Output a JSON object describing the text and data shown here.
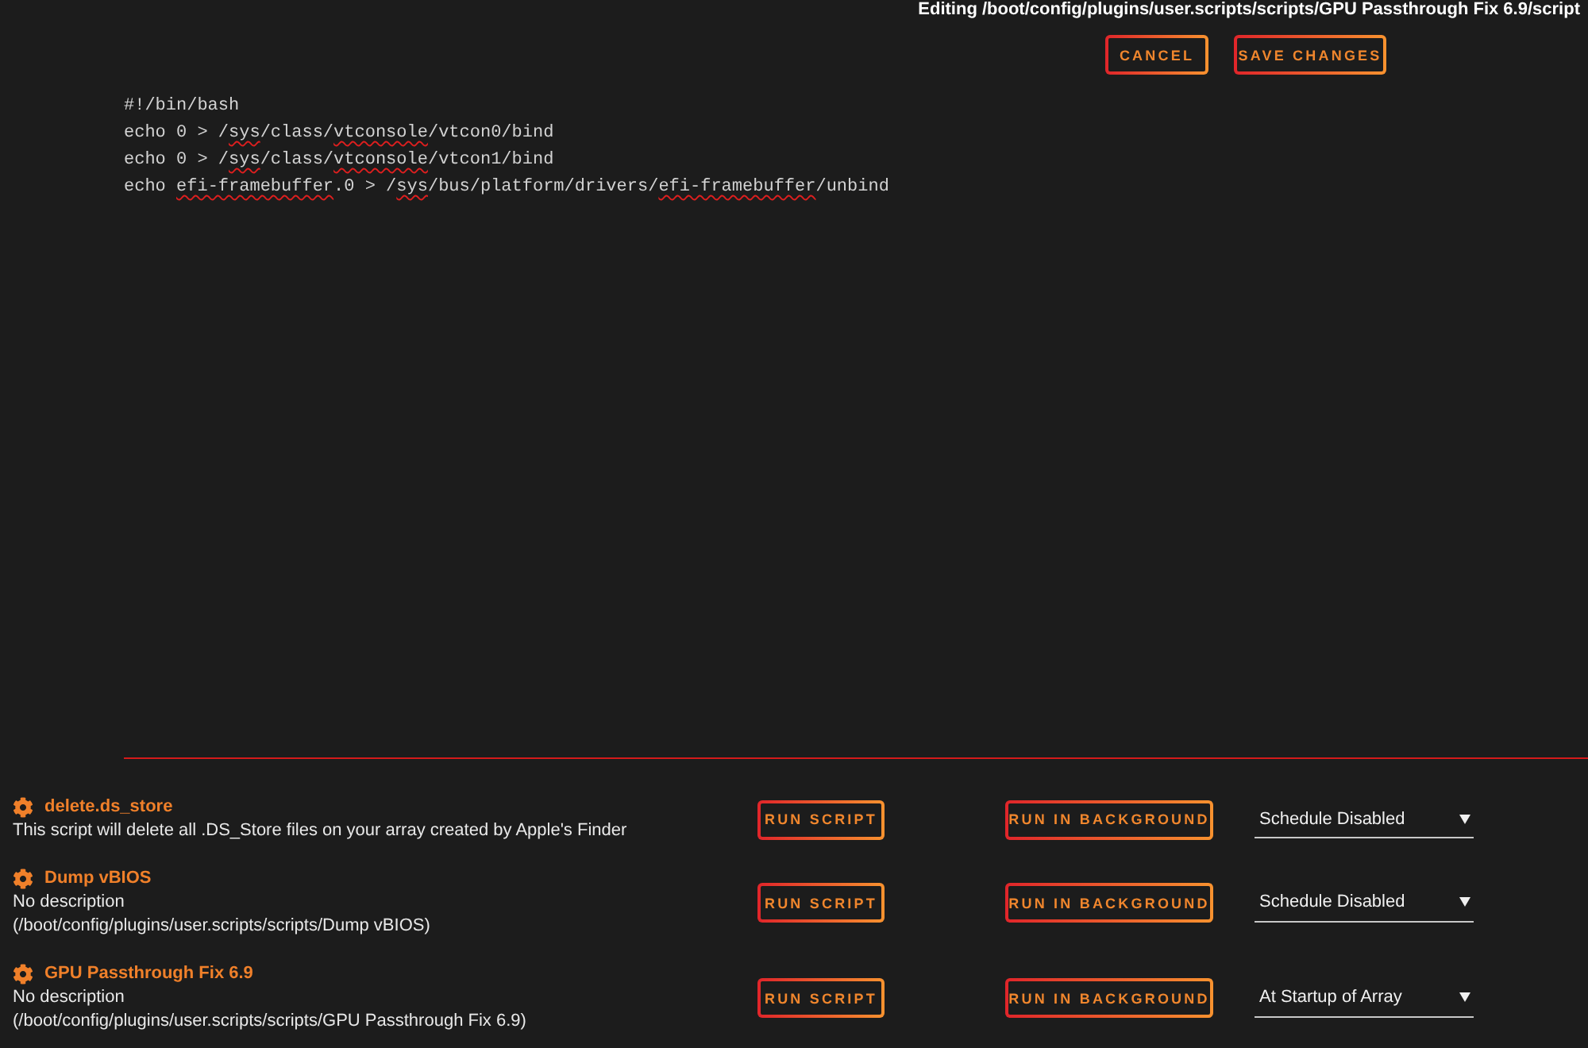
{
  "header": {
    "title": "Editing /boot/config/plugins/user.scripts/scripts/GPU Passthrough Fix 6.9/script",
    "buttons": [
      "CANCEL",
      "SAVE CHANGES"
    ]
  },
  "editor": {
    "lines": [
      {
        "segments": [
          {
            "text": "#!/bin/bash",
            "misspelled": false
          }
        ]
      },
      {
        "segments": [
          {
            "text": "echo 0 > /",
            "misspelled": false
          },
          {
            "text": "sys",
            "misspelled": true
          },
          {
            "text": "/class/",
            "misspelled": false
          },
          {
            "text": "vtconsole",
            "misspelled": true
          },
          {
            "text": "/vtcon0/bind",
            "misspelled": false
          }
        ]
      },
      {
        "segments": [
          {
            "text": "echo 0 > /",
            "misspelled": false
          },
          {
            "text": "sys",
            "misspelled": true
          },
          {
            "text": "/class/",
            "misspelled": false
          },
          {
            "text": "vtconsole",
            "misspelled": true
          },
          {
            "text": "/vtcon1/bind",
            "misspelled": false
          }
        ]
      },
      {
        "segments": [
          {
            "text": "echo ",
            "misspelled": false
          },
          {
            "text": "efi-framebuffer",
            "misspelled": true
          },
          {
            "text": ".0 > /",
            "misspelled": false
          },
          {
            "text": "sys",
            "misspelled": true
          },
          {
            "text": "/bus/platform/drivers/",
            "misspelled": false
          },
          {
            "text": "efi-framebuffer",
            "misspelled": true
          },
          {
            "text": "/unbind",
            "misspelled": false
          }
        ]
      }
    ]
  },
  "scripts": [
    {
      "name": "delete.ds_store",
      "description": "This script will delete all .DS_Store files on your array created by Apple's Finder",
      "run_label": "RUN SCRIPT",
      "background_label": "RUN IN BACKGROUND",
      "schedule": "Schedule Disabled"
    },
    {
      "name": "Dump vBIOS",
      "description": "No description",
      "path": "(/boot/config/plugins/user.scripts/scripts/Dump vBIOS)",
      "run_label": "RUN SCRIPT",
      "background_label": "RUN IN BACKGROUND",
      "schedule": "Schedule Disabled"
    },
    {
      "name": "GPU Passthrough Fix 6.9",
      "description": "No description",
      "path": "(/boot/config/plugins/user.scripts/scripts/GPU Passthrough Fix 6.9)",
      "run_label": "RUN SCRIPT",
      "background_label": "RUN IN BACKGROUND",
      "schedule": "At Startup of Array"
    }
  ]
}
